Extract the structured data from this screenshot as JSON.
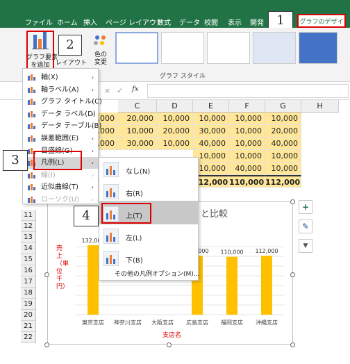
{
  "ribbon": {
    "tabs": [
      "ファイル",
      "ホーム",
      "挿入",
      "ページ レイアウト",
      "数式",
      "データ",
      "校閲",
      "表示",
      "開発"
    ],
    "active_tab": "グラフのデザイン",
    "add_element_label_1": "グラフ要素",
    "add_element_label_2": "を追加",
    "quick_layout_label": "レイアウト",
    "color_label_1": "色の",
    "color_label_2": "変更",
    "group_label": "グラフ スタイル"
  },
  "formula_bar": {
    "fx": "fx",
    "cancel": "×",
    "enter": "✓"
  },
  "columns": [
    "C",
    "D",
    "E",
    "F",
    "G",
    "H"
  ],
  "rows": [
    "11",
    "12",
    "13",
    "14",
    "15",
    "16",
    "17",
    "18",
    "19",
    "20",
    "21",
    "22"
  ],
  "table": {
    "row1": [
      "20,000",
      "10,000",
      "10,000",
      "10,000",
      "10,000"
    ],
    "row2": [
      "10,000",
      "20,000",
      "30,000",
      "10,000",
      "20,000"
    ],
    "row3": [
      "30,000",
      "10,000",
      "40,000",
      "10,000",
      "40,000"
    ],
    "row4": [
      "10,000",
      "10,000",
      "10,000"
    ],
    "row5": [
      "10,000",
      "40,000",
      "10,000"
    ],
    "totals": [
      "112,000",
      "110,000",
      "112,000"
    ],
    "b_partial": [
      ",000",
      ",000",
      ",000"
    ]
  },
  "element_menu": {
    "items": [
      {
        "label": "軸(X)",
        "arrow": "›"
      },
      {
        "label": "軸ラベル(A)",
        "arrow": "›"
      },
      {
        "label": "グラフ タイトル(C)",
        "arrow": "›"
      },
      {
        "label": "データ ラベル(D)",
        "arrow": "›"
      },
      {
        "label": "データ テーブル(B)",
        "arrow": "›"
      },
      {
        "label": "誤差範囲(E)",
        "arrow": "›"
      },
      {
        "label": "目盛線(G)",
        "arrow": "›"
      },
      {
        "label": "凡例(L)",
        "arrow": "›"
      },
      {
        "label": "線(I)",
        "arrow": "›"
      },
      {
        "label": "近似曲線(T)",
        "arrow": "›"
      },
      {
        "label": "ローソク(U)",
        "arrow": "›"
      }
    ]
  },
  "legend_menu": {
    "items": [
      "なし(N)",
      "右(R)",
      "上(T)",
      "左(L)",
      "下(B)"
    ],
    "more": "その他の凡例オプション(M)..."
  },
  "callouts": [
    "1",
    "2",
    "3",
    "4"
  ],
  "chart": {
    "title_visible": "と比較",
    "side_buttons": [
      "+",
      "✎",
      "▼"
    ]
  },
  "chart_data": {
    "type": "bar",
    "categories": [
      "東京支店",
      "神奈川支店",
      "大阪支店",
      "広島支店",
      "福岡支店",
      "沖縄支店"
    ],
    "values": [
      132000,
      0,
      0,
      112000,
      110000,
      112000
    ],
    "data_labels": [
      "132,000",
      "",
      "",
      "112,000",
      "110,000",
      "112,000"
    ],
    "ylabel": "売上（単位 千円）",
    "xlabel": "支店名",
    "bar_color": "#ffc000",
    "label_color": "#d00000"
  }
}
